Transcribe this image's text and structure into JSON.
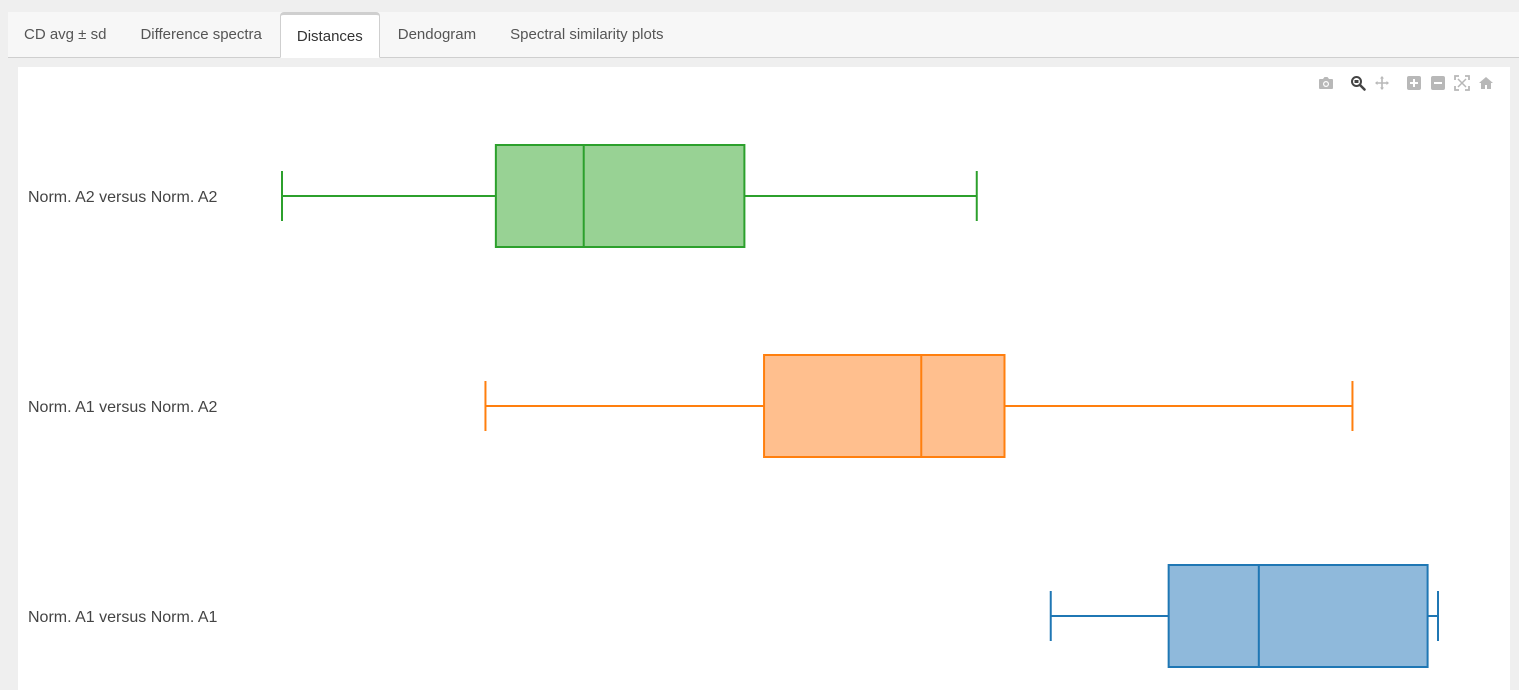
{
  "tabs": [
    {
      "label": "CD avg ± sd",
      "active": false
    },
    {
      "label": "Difference spectra",
      "active": false
    },
    {
      "label": "Distances",
      "active": true
    },
    {
      "label": "Dendogram",
      "active": false
    },
    {
      "label": "Spectral similarity plots",
      "active": false
    }
  ],
  "modebar": {
    "icons": [
      "camera-icon",
      "zoom-icon",
      "pan-icon",
      "zoom-in-icon",
      "zoom-out-icon",
      "autoscale-icon",
      "reset-axes-icon"
    ],
    "icon_color": "#b8b8b8",
    "active_icon_color": "#444444"
  },
  "chart_data": {
    "type": "box",
    "orientation": "horizontal",
    "categories": [
      "Norm. A2 versus Norm. A2",
      "Norm. A1 versus Norm. A2",
      "Norm. A1 versus Norm. A1"
    ],
    "xlim": [
      0,
      100
    ],
    "series": [
      {
        "category": "Norm. A2 versus Norm. A2",
        "color": "#2ca02c",
        "fill": "#98d294",
        "min": 0,
        "q1": 18.5,
        "median": 26.1,
        "q3": 40.0,
        "max": 60.1
      },
      {
        "category": "Norm. A1 versus Norm. A2",
        "color": "#ff7f0e",
        "fill": "#ffbf8e",
        "min": 17.6,
        "q1": 41.7,
        "median": 55.3,
        "q3": 62.5,
        "max": 92.6
      },
      {
        "category": "Norm. A1 versus Norm. A1",
        "color": "#1f77b4",
        "fill": "#8fb9db",
        "min": 66.5,
        "q1": 76.7,
        "median": 84.5,
        "q3": 99.1,
        "max": 100
      }
    ]
  }
}
